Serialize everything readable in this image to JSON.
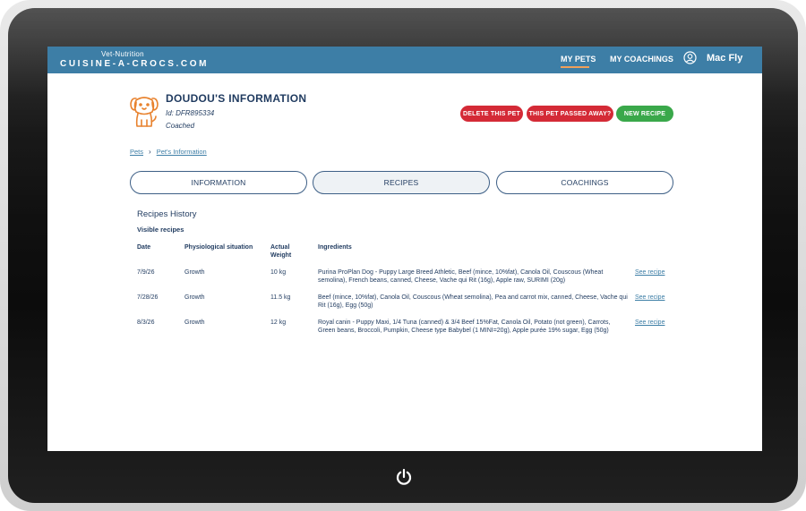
{
  "header": {
    "logo_small": "Vet-Nutrition",
    "logo_main": "CUISINE-A-CROCS.COM",
    "nav": [
      "MY PETS",
      "MY COACHINGS"
    ],
    "user_name": "Mac Fly"
  },
  "pet": {
    "title": "DOUDOU'S INFORMATION",
    "id": "Id: DFR895334",
    "status": "Coached",
    "icon": "dog-icon"
  },
  "actions": {
    "delete": "DELETE THIS PET",
    "passed": "THIS PET PASSED AWAY?",
    "new_recipe": "NEW RECIPE"
  },
  "breadcrumb": [
    "Pets",
    "Pet's Information"
  ],
  "tabs": [
    "INFORMATION",
    "RECIPES",
    "COACHINGS"
  ],
  "active_tab": "RECIPES",
  "recipes": {
    "title": "Recipes History",
    "filter": "Visible recipes",
    "columns": [
      "Date",
      "Physiological situation",
      "Actual Weight",
      "Ingredients"
    ],
    "rows": [
      {
        "date": "7/9/26",
        "situation": "Growth",
        "weight": "10 kg",
        "ingredients": "Purina ProPlan Dog - Puppy Large Breed Athletic, Beef (mince, 10%fat), Canola Oil, Couscous (Wheat semolina), French beans, canned, Cheese, Vache qui Rit (16g), Apple raw, SURIMI (20g)",
        "link": "See recipe"
      },
      {
        "date": "7/28/26",
        "situation": "Growth",
        "weight": "11.5 kg",
        "ingredients": "Beef (mince, 10%fat), Canola Oil, Couscous (Wheat semolina), Pea and carrot mix, canned, Cheese, Vache qui Rit (16g), Egg (50g)",
        "link": "See recipe"
      },
      {
        "date": "8/3/26",
        "situation": "Growth",
        "weight": "12 kg",
        "ingredients": "Royal canin - Puppy Maxi, 1/4 Tuna (canned) & 3/4 Beef 15%Fat, Canola Oil, Potato (not green), Carrots, Green beans, Broccoli, Pumpkin, Cheese type Babybel (1 MINI=20g), Apple purée 19% sugar, Egg (50g)",
        "link": "See recipe"
      }
    ]
  },
  "colors": {
    "topbar": "#3d7ea6",
    "navy": "#1f3a5f",
    "danger": "#d42a36",
    "success": "#3aa84a",
    "accent_orange": "#f0a05a"
  },
  "icons": [
    "power-icon",
    "user-icon",
    "dog-icon",
    "chevron-right-icon"
  ]
}
